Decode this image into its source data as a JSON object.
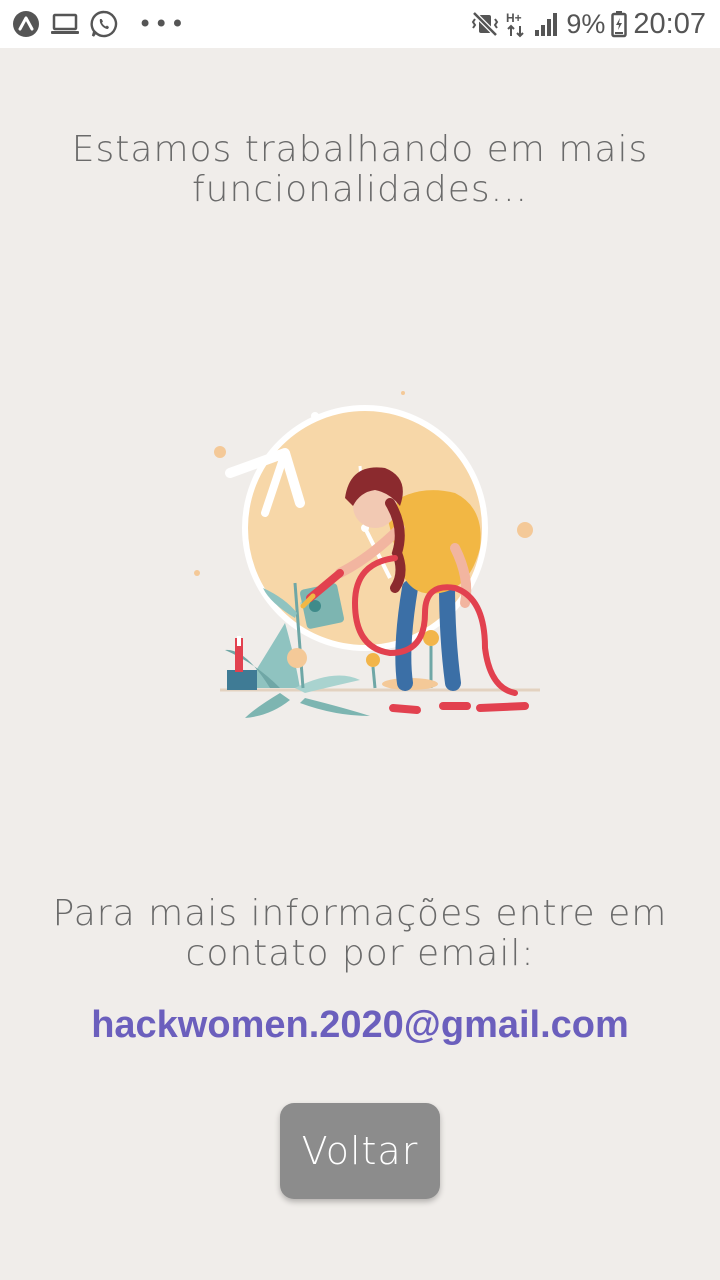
{
  "status_bar": {
    "battery_percent": "9%",
    "time": "20:07",
    "network_type": "H+",
    "left_icons": [
      "app-launcher-icon",
      "laptop-icon",
      "whatsapp-icon",
      "more-dots-icon"
    ],
    "right_icons": [
      "vibrate-mute-icon",
      "network-h-plus-icon",
      "signal-icon",
      "battery-charging-icon"
    ]
  },
  "main": {
    "heading": "Estamos trabalhando em mais funcionalidades...",
    "info_text": "Para mais informações entre em contato por email:",
    "email": "hackwomen.2020@gmail.com",
    "back_button_label": "Voltar"
  },
  "colors": {
    "background": "#f0edea",
    "email_link": "#6b5fbd",
    "button": "#8c8c8c",
    "text": "#6a6a6a"
  }
}
